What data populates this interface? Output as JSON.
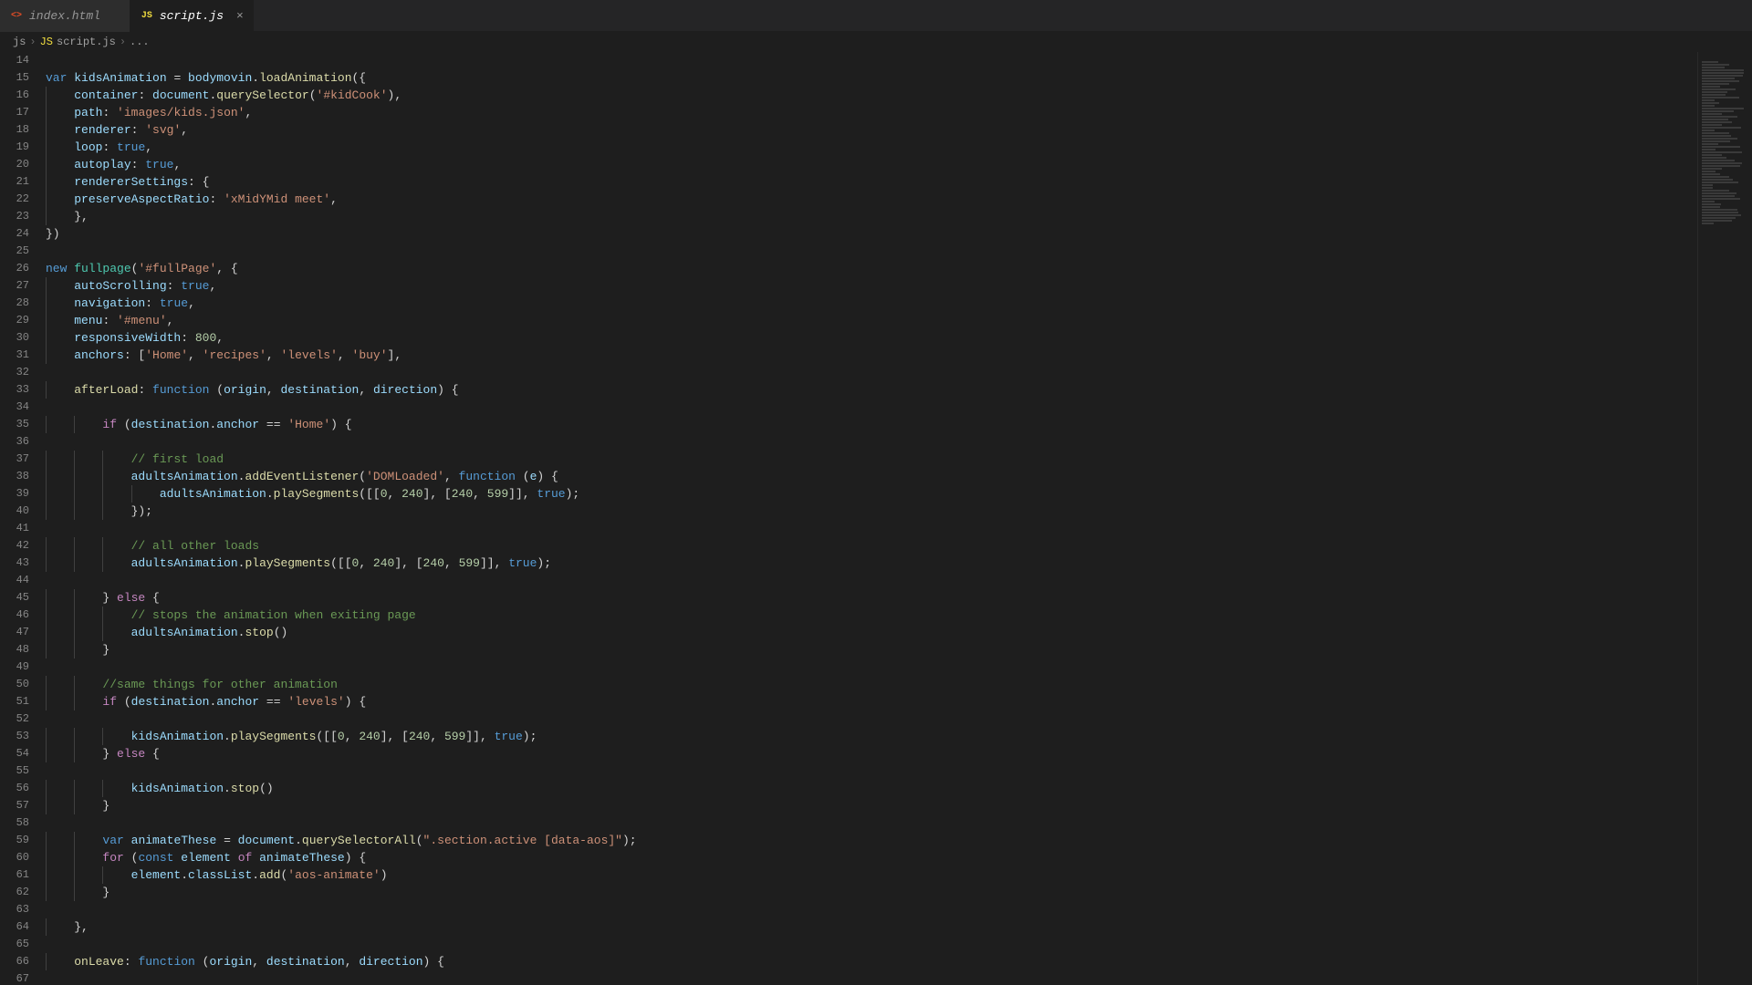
{
  "tabs": [
    {
      "label": "index.html",
      "iconType": "html",
      "iconGlyph": "<>",
      "active": false
    },
    {
      "label": "script.js",
      "iconType": "js",
      "iconGlyph": "JS",
      "active": true
    }
  ],
  "breadcrumb": {
    "seg0": "js",
    "seg1_icon": "JS",
    "seg1": "script.js",
    "seg2": "..."
  },
  "startLine": 14,
  "code": [
    [],
    [
      {
        "t": "kw",
        "v": "var"
      },
      {
        "t": "pn",
        "v": " "
      },
      {
        "t": "id",
        "v": "kidsAnimation"
      },
      {
        "t": "pn",
        "v": " = "
      },
      {
        "t": "id",
        "v": "bodymovin"
      },
      {
        "t": "pn",
        "v": "."
      },
      {
        "t": "fn",
        "v": "loadAnimation"
      },
      {
        "t": "pn",
        "v": "({"
      }
    ],
    [
      {
        "t": "pn",
        "v": "    "
      },
      {
        "t": "id",
        "v": "container"
      },
      {
        "t": "pn",
        "v": ": "
      },
      {
        "t": "id",
        "v": "document"
      },
      {
        "t": "pn",
        "v": "."
      },
      {
        "t": "fn",
        "v": "querySelector"
      },
      {
        "t": "pn",
        "v": "("
      },
      {
        "t": "str",
        "v": "'#kidCook'"
      },
      {
        "t": "pn",
        "v": "),"
      }
    ],
    [
      {
        "t": "pn",
        "v": "    "
      },
      {
        "t": "id",
        "v": "path"
      },
      {
        "t": "pn",
        "v": ": "
      },
      {
        "t": "str",
        "v": "'images/kids.json'"
      },
      {
        "t": "pn",
        "v": ","
      }
    ],
    [
      {
        "t": "pn",
        "v": "    "
      },
      {
        "t": "id",
        "v": "renderer"
      },
      {
        "t": "pn",
        "v": ": "
      },
      {
        "t": "str",
        "v": "'svg'"
      },
      {
        "t": "pn",
        "v": ","
      }
    ],
    [
      {
        "t": "pn",
        "v": "    "
      },
      {
        "t": "id",
        "v": "loop"
      },
      {
        "t": "pn",
        "v": ": "
      },
      {
        "t": "kw",
        "v": "true"
      },
      {
        "t": "pn",
        "v": ","
      }
    ],
    [
      {
        "t": "pn",
        "v": "    "
      },
      {
        "t": "id",
        "v": "autoplay"
      },
      {
        "t": "pn",
        "v": ": "
      },
      {
        "t": "kw",
        "v": "true"
      },
      {
        "t": "pn",
        "v": ","
      }
    ],
    [
      {
        "t": "pn",
        "v": "    "
      },
      {
        "t": "id",
        "v": "rendererSettings"
      },
      {
        "t": "pn",
        "v": ": {"
      }
    ],
    [
      {
        "t": "pn",
        "v": "    "
      },
      {
        "t": "id",
        "v": "preserveAspectRatio"
      },
      {
        "t": "pn",
        "v": ": "
      },
      {
        "t": "str",
        "v": "'xMidYMid meet'"
      },
      {
        "t": "pn",
        "v": ","
      }
    ],
    [
      {
        "t": "pn",
        "v": "    },"
      }
    ],
    [
      {
        "t": "pn",
        "v": "})"
      }
    ],
    [],
    [
      {
        "t": "kw",
        "v": "new"
      },
      {
        "t": "pn",
        "v": " "
      },
      {
        "t": "cls",
        "v": "fullpage"
      },
      {
        "t": "pn",
        "v": "("
      },
      {
        "t": "str",
        "v": "'#fullPage'"
      },
      {
        "t": "pn",
        "v": ", {"
      }
    ],
    [
      {
        "t": "pn",
        "v": "    "
      },
      {
        "t": "id",
        "v": "autoScrolling"
      },
      {
        "t": "pn",
        "v": ": "
      },
      {
        "t": "kw",
        "v": "true"
      },
      {
        "t": "pn",
        "v": ","
      }
    ],
    [
      {
        "t": "pn",
        "v": "    "
      },
      {
        "t": "id",
        "v": "navigation"
      },
      {
        "t": "pn",
        "v": ": "
      },
      {
        "t": "kw",
        "v": "true"
      },
      {
        "t": "pn",
        "v": ","
      }
    ],
    [
      {
        "t": "pn",
        "v": "    "
      },
      {
        "t": "id",
        "v": "menu"
      },
      {
        "t": "pn",
        "v": ": "
      },
      {
        "t": "str",
        "v": "'#menu'"
      },
      {
        "t": "pn",
        "v": ","
      }
    ],
    [
      {
        "t": "pn",
        "v": "    "
      },
      {
        "t": "id",
        "v": "responsiveWidth"
      },
      {
        "t": "pn",
        "v": ": "
      },
      {
        "t": "num",
        "v": "800"
      },
      {
        "t": "pn",
        "v": ","
      }
    ],
    [
      {
        "t": "pn",
        "v": "    "
      },
      {
        "t": "id",
        "v": "anchors"
      },
      {
        "t": "pn",
        "v": ": ["
      },
      {
        "t": "str",
        "v": "'Home'"
      },
      {
        "t": "pn",
        "v": ", "
      },
      {
        "t": "str",
        "v": "'recipes'"
      },
      {
        "t": "pn",
        "v": ", "
      },
      {
        "t": "str",
        "v": "'levels'"
      },
      {
        "t": "pn",
        "v": ", "
      },
      {
        "t": "str",
        "v": "'buy'"
      },
      {
        "t": "pn",
        "v": "],"
      }
    ],
    [],
    [
      {
        "t": "pn",
        "v": "    "
      },
      {
        "t": "fn",
        "v": "afterLoad"
      },
      {
        "t": "pn",
        "v": ": "
      },
      {
        "t": "kw",
        "v": "function"
      },
      {
        "t": "pn",
        "v": " ("
      },
      {
        "t": "id",
        "v": "origin"
      },
      {
        "t": "pn",
        "v": ", "
      },
      {
        "t": "id",
        "v": "destination"
      },
      {
        "t": "pn",
        "v": ", "
      },
      {
        "t": "id",
        "v": "direction"
      },
      {
        "t": "pn",
        "v": ") {"
      }
    ],
    [],
    [
      {
        "t": "pn",
        "v": "        "
      },
      {
        "t": "kw2",
        "v": "if"
      },
      {
        "t": "pn",
        "v": " ("
      },
      {
        "t": "id",
        "v": "destination"
      },
      {
        "t": "pn",
        "v": "."
      },
      {
        "t": "id",
        "v": "anchor"
      },
      {
        "t": "pn",
        "v": " == "
      },
      {
        "t": "str",
        "v": "'Home'"
      },
      {
        "t": "pn",
        "v": ") {"
      }
    ],
    [],
    [
      {
        "t": "pn",
        "v": "            "
      },
      {
        "t": "cm",
        "v": "// first load"
      }
    ],
    [
      {
        "t": "pn",
        "v": "            "
      },
      {
        "t": "id",
        "v": "adultsAnimation"
      },
      {
        "t": "pn",
        "v": "."
      },
      {
        "t": "fn",
        "v": "addEventListener"
      },
      {
        "t": "pn",
        "v": "("
      },
      {
        "t": "str",
        "v": "'DOMLoaded'"
      },
      {
        "t": "pn",
        "v": ", "
      },
      {
        "t": "kw",
        "v": "function"
      },
      {
        "t": "pn",
        "v": " ("
      },
      {
        "t": "id",
        "v": "e"
      },
      {
        "t": "pn",
        "v": ") {"
      }
    ],
    [
      {
        "t": "pn",
        "v": "                "
      },
      {
        "t": "id",
        "v": "adultsAnimation"
      },
      {
        "t": "pn",
        "v": "."
      },
      {
        "t": "fn",
        "v": "playSegments"
      },
      {
        "t": "pn",
        "v": "([["
      },
      {
        "t": "num",
        "v": "0"
      },
      {
        "t": "pn",
        "v": ", "
      },
      {
        "t": "num",
        "v": "240"
      },
      {
        "t": "pn",
        "v": "], ["
      },
      {
        "t": "num",
        "v": "240"
      },
      {
        "t": "pn",
        "v": ", "
      },
      {
        "t": "num",
        "v": "599"
      },
      {
        "t": "pn",
        "v": "]], "
      },
      {
        "t": "kw",
        "v": "true"
      },
      {
        "t": "pn",
        "v": ");"
      }
    ],
    [
      {
        "t": "pn",
        "v": "            });"
      }
    ],
    [],
    [
      {
        "t": "pn",
        "v": "            "
      },
      {
        "t": "cm",
        "v": "// all other loads"
      }
    ],
    [
      {
        "t": "pn",
        "v": "            "
      },
      {
        "t": "id",
        "v": "adultsAnimation"
      },
      {
        "t": "pn",
        "v": "."
      },
      {
        "t": "fn",
        "v": "playSegments"
      },
      {
        "t": "pn",
        "v": "([["
      },
      {
        "t": "num",
        "v": "0"
      },
      {
        "t": "pn",
        "v": ", "
      },
      {
        "t": "num",
        "v": "240"
      },
      {
        "t": "pn",
        "v": "], ["
      },
      {
        "t": "num",
        "v": "240"
      },
      {
        "t": "pn",
        "v": ", "
      },
      {
        "t": "num",
        "v": "599"
      },
      {
        "t": "pn",
        "v": "]], "
      },
      {
        "t": "kw",
        "v": "true"
      },
      {
        "t": "pn",
        "v": ");"
      }
    ],
    [],
    [
      {
        "t": "pn",
        "v": "        } "
      },
      {
        "t": "kw2",
        "v": "else"
      },
      {
        "t": "pn",
        "v": " {"
      }
    ],
    [
      {
        "t": "pn",
        "v": "            "
      },
      {
        "t": "cm",
        "v": "// stops the animation when exiting page"
      }
    ],
    [
      {
        "t": "pn",
        "v": "            "
      },
      {
        "t": "id",
        "v": "adultsAnimation"
      },
      {
        "t": "pn",
        "v": "."
      },
      {
        "t": "fn",
        "v": "stop"
      },
      {
        "t": "pn",
        "v": "()"
      }
    ],
    [
      {
        "t": "pn",
        "v": "        }"
      }
    ],
    [],
    [
      {
        "t": "pn",
        "v": "        "
      },
      {
        "t": "cm",
        "v": "//same things for other animation"
      }
    ],
    [
      {
        "t": "pn",
        "v": "        "
      },
      {
        "t": "kw2",
        "v": "if"
      },
      {
        "t": "pn",
        "v": " ("
      },
      {
        "t": "id",
        "v": "destination"
      },
      {
        "t": "pn",
        "v": "."
      },
      {
        "t": "id",
        "v": "anchor"
      },
      {
        "t": "pn",
        "v": " == "
      },
      {
        "t": "str",
        "v": "'levels'"
      },
      {
        "t": "pn",
        "v": ") {"
      }
    ],
    [],
    [
      {
        "t": "pn",
        "v": "            "
      },
      {
        "t": "id",
        "v": "kidsAnimation"
      },
      {
        "t": "pn",
        "v": "."
      },
      {
        "t": "fn",
        "v": "playSegments"
      },
      {
        "t": "pn",
        "v": "([["
      },
      {
        "t": "num",
        "v": "0"
      },
      {
        "t": "pn",
        "v": ", "
      },
      {
        "t": "num",
        "v": "240"
      },
      {
        "t": "pn",
        "v": "], ["
      },
      {
        "t": "num",
        "v": "240"
      },
      {
        "t": "pn",
        "v": ", "
      },
      {
        "t": "num",
        "v": "599"
      },
      {
        "t": "pn",
        "v": "]], "
      },
      {
        "t": "kw",
        "v": "true"
      },
      {
        "t": "pn",
        "v": ");"
      }
    ],
    [
      {
        "t": "pn",
        "v": "        } "
      },
      {
        "t": "kw2",
        "v": "else"
      },
      {
        "t": "pn",
        "v": " {"
      }
    ],
    [],
    [
      {
        "t": "pn",
        "v": "            "
      },
      {
        "t": "id",
        "v": "kidsAnimation"
      },
      {
        "t": "pn",
        "v": "."
      },
      {
        "t": "fn",
        "v": "stop"
      },
      {
        "t": "pn",
        "v": "()"
      }
    ],
    [
      {
        "t": "pn",
        "v": "        }"
      }
    ],
    [],
    [
      {
        "t": "pn",
        "v": "        "
      },
      {
        "t": "kw",
        "v": "var"
      },
      {
        "t": "pn",
        "v": " "
      },
      {
        "t": "id",
        "v": "animateThese"
      },
      {
        "t": "pn",
        "v": " = "
      },
      {
        "t": "id",
        "v": "document"
      },
      {
        "t": "pn",
        "v": "."
      },
      {
        "t": "fn",
        "v": "querySelectorAll"
      },
      {
        "t": "pn",
        "v": "("
      },
      {
        "t": "str",
        "v": "\".section.active [data-aos]\""
      },
      {
        "t": "pn",
        "v": ");"
      }
    ],
    [
      {
        "t": "pn",
        "v": "        "
      },
      {
        "t": "kw2",
        "v": "for"
      },
      {
        "t": "pn",
        "v": " ("
      },
      {
        "t": "kw",
        "v": "const"
      },
      {
        "t": "pn",
        "v": " "
      },
      {
        "t": "id",
        "v": "element"
      },
      {
        "t": "pn",
        "v": " "
      },
      {
        "t": "kw2",
        "v": "of"
      },
      {
        "t": "pn",
        "v": " "
      },
      {
        "t": "id",
        "v": "animateThese"
      },
      {
        "t": "pn",
        "v": ") {"
      }
    ],
    [
      {
        "t": "pn",
        "v": "            "
      },
      {
        "t": "id",
        "v": "element"
      },
      {
        "t": "pn",
        "v": "."
      },
      {
        "t": "id",
        "v": "classList"
      },
      {
        "t": "pn",
        "v": "."
      },
      {
        "t": "fn",
        "v": "add"
      },
      {
        "t": "pn",
        "v": "("
      },
      {
        "t": "str",
        "v": "'aos-animate'"
      },
      {
        "t": "pn",
        "v": ")"
      }
    ],
    [
      {
        "t": "pn",
        "v": "        }"
      }
    ],
    [],
    [
      {
        "t": "pn",
        "v": "    },"
      }
    ],
    [],
    [
      {
        "t": "pn",
        "v": "    "
      },
      {
        "t": "fn",
        "v": "onLeave"
      },
      {
        "t": "pn",
        "v": ": "
      },
      {
        "t": "kw",
        "v": "function"
      },
      {
        "t": "pn",
        "v": " ("
      },
      {
        "t": "id",
        "v": "origin"
      },
      {
        "t": "pn",
        "v": ", "
      },
      {
        "t": "id",
        "v": "destination"
      },
      {
        "t": "pn",
        "v": ", "
      },
      {
        "t": "id",
        "v": "direction"
      },
      {
        "t": "pn",
        "v": ") {"
      }
    ],
    []
  ]
}
